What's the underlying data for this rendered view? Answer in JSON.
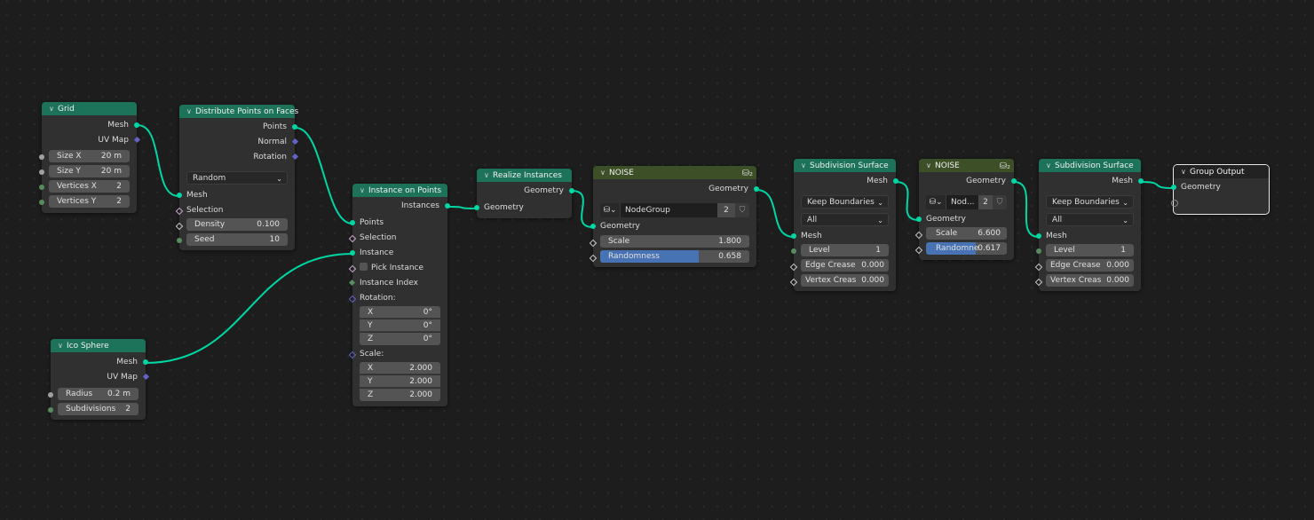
{
  "editor": "Geometry Node Editor",
  "colors": {
    "link": "#00d6a3",
    "geometry_header": "#1c7359",
    "group_header": "#3d4f26",
    "slider_fill": "#4772b3"
  },
  "nodes": {
    "grid": {
      "title": "Grid",
      "outputs": [
        "Mesh",
        "UV Map"
      ],
      "fields": [
        {
          "label": "Size X",
          "value": "20 m"
        },
        {
          "label": "Size Y",
          "value": "20 m"
        },
        {
          "label": "Vertices X",
          "value": "2"
        },
        {
          "label": "Vertices Y",
          "value": "2"
        }
      ]
    },
    "distribute": {
      "title": "Distribute Points on Faces",
      "outputs": [
        "Points",
        "Normal",
        "Rotation"
      ],
      "mode": "Random",
      "inputs": [
        "Mesh",
        "Selection"
      ],
      "fields": [
        {
          "label": "Density",
          "value": "0.100"
        },
        {
          "label": "Seed",
          "value": "10"
        }
      ]
    },
    "ico": {
      "title": "Ico Sphere",
      "outputs": [
        "Mesh",
        "UV Map"
      ],
      "fields": [
        {
          "label": "Radius",
          "value": "0.2 m"
        },
        {
          "label": "Subdivisions",
          "value": "2"
        }
      ]
    },
    "instance": {
      "title": "Instance on Points",
      "outputs": [
        "Instances"
      ],
      "inputs": [
        "Points",
        "Selection",
        "Instance",
        "Pick Instance",
        "Instance Index",
        "Rotation:",
        "Scale:"
      ],
      "rotation": [
        {
          "label": "X",
          "value": "0°"
        },
        {
          "label": "Y",
          "value": "0°"
        },
        {
          "label": "Z",
          "value": "0°"
        }
      ],
      "scale": [
        {
          "label": "X",
          "value": "2.000"
        },
        {
          "label": "Y",
          "value": "2.000"
        },
        {
          "label": "Z",
          "value": "2.000"
        }
      ]
    },
    "realize": {
      "title": "Realize Instances",
      "outputs": [
        "Geometry"
      ],
      "inputs": [
        "Geometry"
      ]
    },
    "noise1": {
      "title": "NOISE",
      "outputs": [
        "Geometry"
      ],
      "group_name": "NodeGroup",
      "users": "2",
      "inputs": [
        "Geometry"
      ],
      "scale": {
        "label": "Scale",
        "value": "1.800"
      },
      "randomness": {
        "label": "Randomness",
        "value": "0.658",
        "fraction": 0.658
      }
    },
    "subdiv1": {
      "title": "Subdivision Surface",
      "outputs": [
        "Mesh"
      ],
      "boundary": "Keep Boundaries",
      "uv": "All",
      "inputs": [
        "Mesh"
      ],
      "fields": [
        {
          "label": "Level",
          "value": "1"
        },
        {
          "label": "Edge Crease",
          "value": "0.000"
        },
        {
          "label": "Vertex Creas",
          "value": "0.000"
        }
      ]
    },
    "noise2": {
      "title": "NOISE",
      "outputs": [
        "Geometry"
      ],
      "group_name": "Nod...",
      "users": "2",
      "inputs": [
        "Geometry"
      ],
      "scale": {
        "label": "Scale",
        "value": "6.600"
      },
      "randomness": {
        "label": "Randomne",
        "value": "0.617",
        "fraction": 0.617
      }
    },
    "subdiv2": {
      "title": "Subdivision Surface",
      "outputs": [
        "Mesh"
      ],
      "boundary": "Keep Boundaries",
      "uv": "All",
      "inputs": [
        "Mesh"
      ],
      "fields": [
        {
          "label": "Level",
          "value": "1"
        },
        {
          "label": "Edge Crease",
          "value": "0.000"
        },
        {
          "label": "Vertex Creas",
          "value": "0.000"
        }
      ]
    },
    "output": {
      "title": "Group Output",
      "inputs": [
        "Geometry"
      ]
    }
  },
  "links": [
    {
      "from": "grid.Mesh",
      "to": "distribute.Mesh"
    },
    {
      "from": "distribute.Points",
      "to": "instance.Points"
    },
    {
      "from": "ico.Mesh",
      "to": "instance.Instance"
    },
    {
      "from": "instance.Instances",
      "to": "realize.Geometry"
    },
    {
      "from": "realize.Geometry",
      "to": "noise1.Geometry"
    },
    {
      "from": "noise1.Geometry",
      "to": "subdiv1.Mesh"
    },
    {
      "from": "subdiv1.Mesh",
      "to": "noise2.Geometry"
    },
    {
      "from": "noise2.Geometry",
      "to": "subdiv2.Mesh"
    },
    {
      "from": "subdiv2.Mesh",
      "to": "output.Geometry"
    }
  ]
}
